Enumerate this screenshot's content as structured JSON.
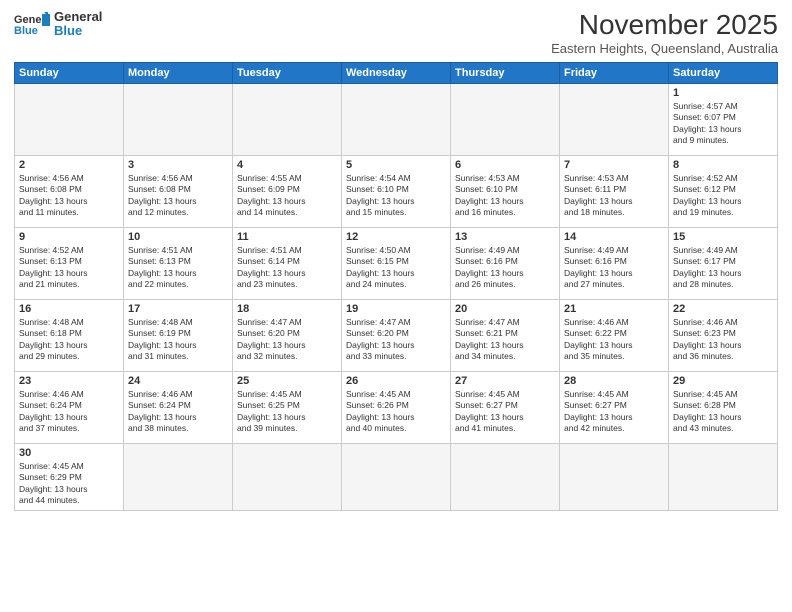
{
  "logo": {
    "line1": "General",
    "line2": "Blue"
  },
  "header": {
    "title": "November 2025",
    "subtitle": "Eastern Heights, Queensland, Australia"
  },
  "weekdays": [
    "Sunday",
    "Monday",
    "Tuesday",
    "Wednesday",
    "Thursday",
    "Friday",
    "Saturday"
  ],
  "weeks": [
    [
      {
        "day": "",
        "info": ""
      },
      {
        "day": "",
        "info": ""
      },
      {
        "day": "",
        "info": ""
      },
      {
        "day": "",
        "info": ""
      },
      {
        "day": "",
        "info": ""
      },
      {
        "day": "",
        "info": ""
      },
      {
        "day": "1",
        "info": "Sunrise: 4:57 AM\nSunset: 6:07 PM\nDaylight: 13 hours\nand 9 minutes."
      }
    ],
    [
      {
        "day": "2",
        "info": "Sunrise: 4:56 AM\nSunset: 6:08 PM\nDaylight: 13 hours\nand 11 minutes."
      },
      {
        "day": "3",
        "info": "Sunrise: 4:56 AM\nSunset: 6:08 PM\nDaylight: 13 hours\nand 12 minutes."
      },
      {
        "day": "4",
        "info": "Sunrise: 4:55 AM\nSunset: 6:09 PM\nDaylight: 13 hours\nand 14 minutes."
      },
      {
        "day": "5",
        "info": "Sunrise: 4:54 AM\nSunset: 6:10 PM\nDaylight: 13 hours\nand 15 minutes."
      },
      {
        "day": "6",
        "info": "Sunrise: 4:53 AM\nSunset: 6:10 PM\nDaylight: 13 hours\nand 16 minutes."
      },
      {
        "day": "7",
        "info": "Sunrise: 4:53 AM\nSunset: 6:11 PM\nDaylight: 13 hours\nand 18 minutes."
      },
      {
        "day": "8",
        "info": "Sunrise: 4:52 AM\nSunset: 6:12 PM\nDaylight: 13 hours\nand 19 minutes."
      }
    ],
    [
      {
        "day": "9",
        "info": "Sunrise: 4:52 AM\nSunset: 6:13 PM\nDaylight: 13 hours\nand 21 minutes."
      },
      {
        "day": "10",
        "info": "Sunrise: 4:51 AM\nSunset: 6:13 PM\nDaylight: 13 hours\nand 22 minutes."
      },
      {
        "day": "11",
        "info": "Sunrise: 4:51 AM\nSunset: 6:14 PM\nDaylight: 13 hours\nand 23 minutes."
      },
      {
        "day": "12",
        "info": "Sunrise: 4:50 AM\nSunset: 6:15 PM\nDaylight: 13 hours\nand 24 minutes."
      },
      {
        "day": "13",
        "info": "Sunrise: 4:49 AM\nSunset: 6:16 PM\nDaylight: 13 hours\nand 26 minutes."
      },
      {
        "day": "14",
        "info": "Sunrise: 4:49 AM\nSunset: 6:16 PM\nDaylight: 13 hours\nand 27 minutes."
      },
      {
        "day": "15",
        "info": "Sunrise: 4:49 AM\nSunset: 6:17 PM\nDaylight: 13 hours\nand 28 minutes."
      }
    ],
    [
      {
        "day": "16",
        "info": "Sunrise: 4:48 AM\nSunset: 6:18 PM\nDaylight: 13 hours\nand 29 minutes."
      },
      {
        "day": "17",
        "info": "Sunrise: 4:48 AM\nSunset: 6:19 PM\nDaylight: 13 hours\nand 31 minutes."
      },
      {
        "day": "18",
        "info": "Sunrise: 4:47 AM\nSunset: 6:20 PM\nDaylight: 13 hours\nand 32 minutes."
      },
      {
        "day": "19",
        "info": "Sunrise: 4:47 AM\nSunset: 6:20 PM\nDaylight: 13 hours\nand 33 minutes."
      },
      {
        "day": "20",
        "info": "Sunrise: 4:47 AM\nSunset: 6:21 PM\nDaylight: 13 hours\nand 34 minutes."
      },
      {
        "day": "21",
        "info": "Sunrise: 4:46 AM\nSunset: 6:22 PM\nDaylight: 13 hours\nand 35 minutes."
      },
      {
        "day": "22",
        "info": "Sunrise: 4:46 AM\nSunset: 6:23 PM\nDaylight: 13 hours\nand 36 minutes."
      }
    ],
    [
      {
        "day": "23",
        "info": "Sunrise: 4:46 AM\nSunset: 6:24 PM\nDaylight: 13 hours\nand 37 minutes."
      },
      {
        "day": "24",
        "info": "Sunrise: 4:46 AM\nSunset: 6:24 PM\nDaylight: 13 hours\nand 38 minutes."
      },
      {
        "day": "25",
        "info": "Sunrise: 4:45 AM\nSunset: 6:25 PM\nDaylight: 13 hours\nand 39 minutes."
      },
      {
        "day": "26",
        "info": "Sunrise: 4:45 AM\nSunset: 6:26 PM\nDaylight: 13 hours\nand 40 minutes."
      },
      {
        "day": "27",
        "info": "Sunrise: 4:45 AM\nSunset: 6:27 PM\nDaylight: 13 hours\nand 41 minutes."
      },
      {
        "day": "28",
        "info": "Sunrise: 4:45 AM\nSunset: 6:27 PM\nDaylight: 13 hours\nand 42 minutes."
      },
      {
        "day": "29",
        "info": "Sunrise: 4:45 AM\nSunset: 6:28 PM\nDaylight: 13 hours\nand 43 minutes."
      }
    ],
    [
      {
        "day": "30",
        "info": "Sunrise: 4:45 AM\nSunset: 6:29 PM\nDaylight: 13 hours\nand 44 minutes."
      },
      {
        "day": "",
        "info": ""
      },
      {
        "day": "",
        "info": ""
      },
      {
        "day": "",
        "info": ""
      },
      {
        "day": "",
        "info": ""
      },
      {
        "day": "",
        "info": ""
      },
      {
        "day": "",
        "info": ""
      }
    ]
  ]
}
